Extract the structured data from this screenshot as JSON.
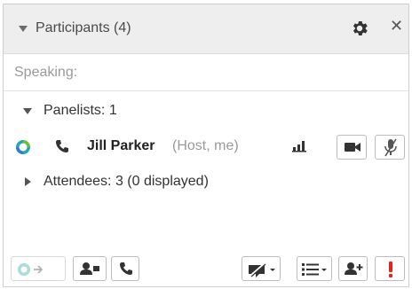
{
  "header": {
    "title": "Participants (4)"
  },
  "speaking": {
    "label": "Speaking:"
  },
  "panelists": {
    "label": "Panelists: 1",
    "members": [
      {
        "name": "Jill Parker",
        "role": "(Host, me)"
      }
    ]
  },
  "attendees": {
    "label": "Attendees: 3 (0 displayed)"
  },
  "colors": {
    "header_bg": "#eeeeee",
    "status_teal": "#1fa9b8",
    "status_green": "#6abf3a",
    "alert_red": "#e8221c",
    "icon_dark": "#333333"
  },
  "icons": [
    "gear-icon",
    "close-icon",
    "phone-icon",
    "signal-icon",
    "video-camera-icon",
    "mic-muted-icon",
    "assign-icon",
    "add-contact-icon",
    "mute-icon",
    "list-icon",
    "invite-user-icon",
    "expel-alert-icon"
  ]
}
